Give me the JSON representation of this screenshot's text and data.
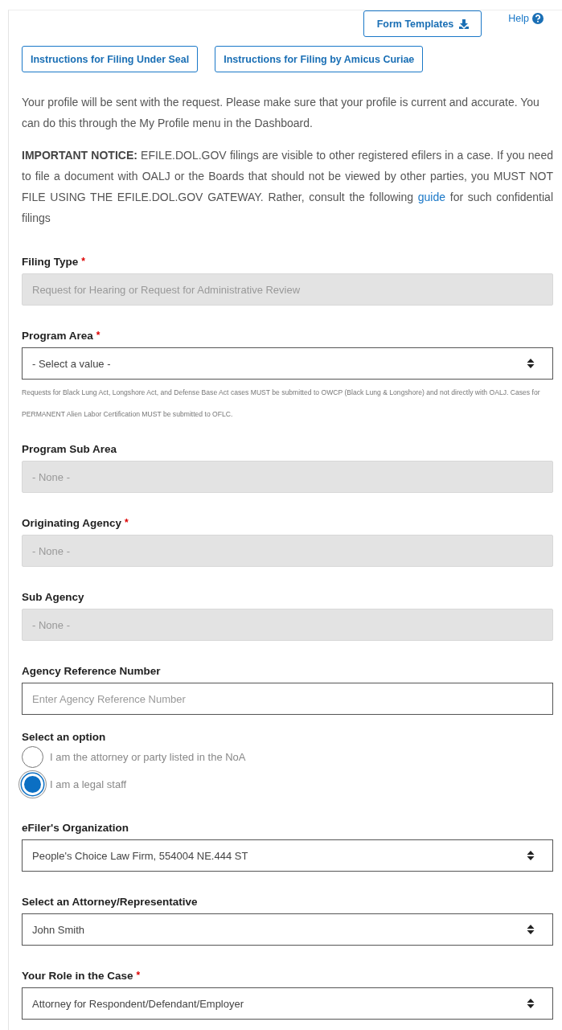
{
  "top_actions": {
    "form_templates": "Form Templates",
    "help": "Help"
  },
  "instruction_buttons": [
    "Instructions for Filing Under Seal",
    "Instructions for Filing by Amicus Curiae"
  ],
  "profile_note": "Your profile will be sent with the request. Please make sure that your profile is current and accurate. You can do this through the My Profile menu in the Dashboard.",
  "notice": {
    "text": "**IMPORTANT NOTICE:** EFILE.DOL.GOV filings are visible to other registered efilers in a case. If you need to file a document with OALJ or the Boards that should not be viewed by other parties, you MUST NOT FILE USING THE EFILE.DOL.GOV GATEWAY. Rather, consult the following",
    "link": "guide",
    "after": "for such confidential filings"
  },
  "fields": [
    {
      "kind": "readonly",
      "label": "Filing Type",
      "required_mark": "*",
      "value": "Request for Hearing or Request for Administrative Review"
    },
    {
      "kind": "select",
      "label": "Program Area",
      "required_mark": "*",
      "value": "- Select a value -",
      "help": "Requests for Black Lung Act, Longshore Act, and Defense Base Act cases MUST be submitted to OWCP (Black Lung & Longshore) and not directly with OALJ. Cases for PERMANENT Alien Labor Certification MUST be submitted to OFLC."
    },
    {
      "kind": "readonly",
      "label": "Program Sub Area",
      "value": "- None -"
    },
    {
      "kind": "readonly",
      "label": "Originating Agency",
      "required_mark": "*",
      "value": "- None -"
    },
    {
      "kind": "readonly",
      "label": "Sub Agency",
      "value": "- None -"
    },
    {
      "kind": "input",
      "label": "Agency Reference Number",
      "placeholder": "Enter Agency Reference Number"
    },
    {
      "kind": "radio",
      "label": "Select an option",
      "options": [
        {
          "label": "I am the attorney or party listed in the NoA",
          "selected": false
        },
        {
          "label": "I am a legal staff",
          "selected": true
        }
      ]
    },
    {
      "kind": "select",
      "label": "eFiler's Organization",
      "value": "People's Choice Law Firm, 554004 NE.444 ST"
    },
    {
      "kind": "select",
      "label": "Select an Attorney/Representative",
      "value": "John Smith"
    },
    {
      "kind": "select",
      "label": "Your Role in the Case",
      "required_mark": "*",
      "value": "Attorney for Respondent/Defendant/Employer"
    }
  ]
}
